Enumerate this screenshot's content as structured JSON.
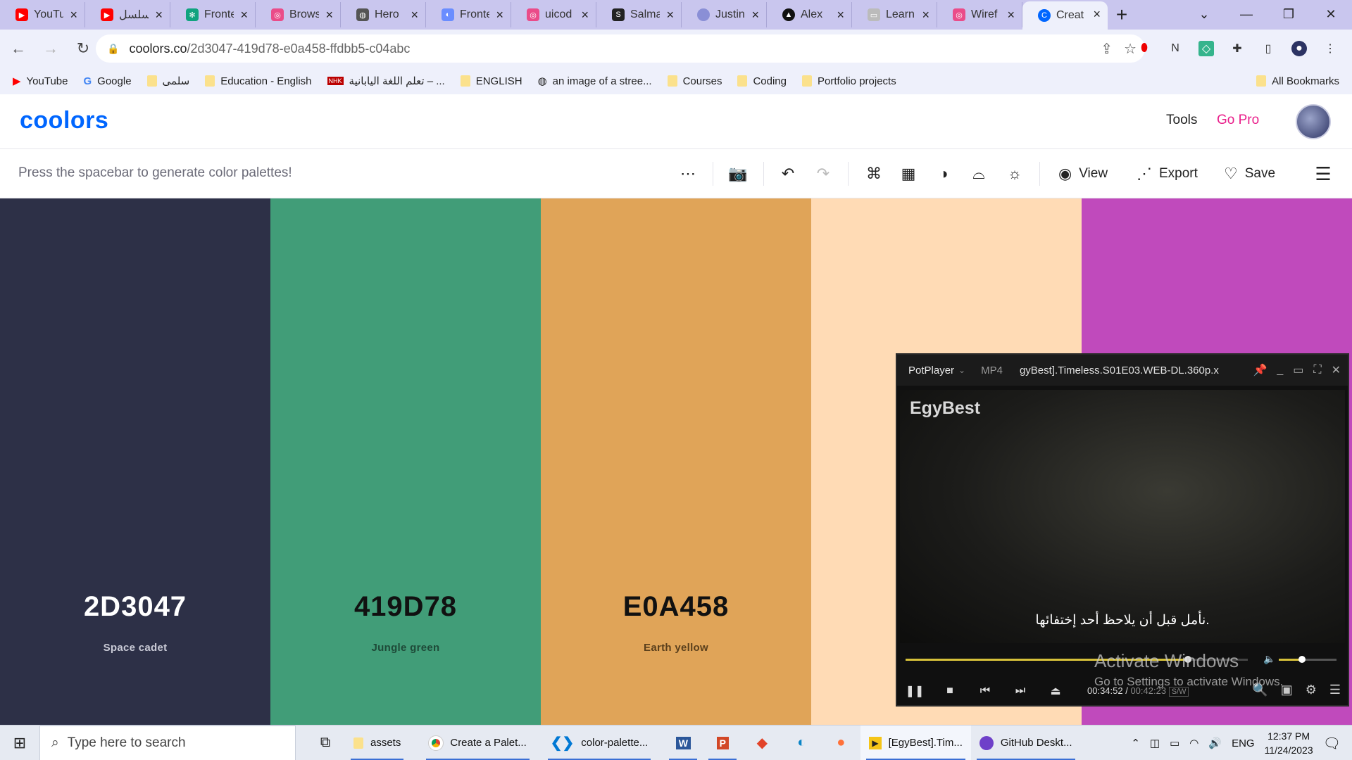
{
  "browser": {
    "tabs": [
      {
        "title": "YouTube",
        "icon": "youtube-icon",
        "color": "#ff0000"
      },
      {
        "title": "مسلسل",
        "icon": "youtube-icon",
        "color": "#ff0000"
      },
      {
        "title": "Frontend",
        "icon": "chatgpt-icon",
        "color": "#10a37f"
      },
      {
        "title": "Browse",
        "icon": "dribbble-icon",
        "color": "#ea4c89"
      },
      {
        "title": "Hero",
        "icon": "globe-icon",
        "color": "#555555"
      },
      {
        "title": "Frontend",
        "icon": "frontend-icon",
        "color": "#6a8dff"
      },
      {
        "title": "uicod",
        "icon": "dribbble-icon",
        "color": "#ea4c89"
      },
      {
        "title": "Salma",
        "icon": "s-icon",
        "color": "#222222"
      },
      {
        "title": "Justin",
        "icon": "avatar-icon",
        "color": "#8a8fd6"
      },
      {
        "title": "Alex",
        "icon": "triangle-icon",
        "color": "#111111"
      },
      {
        "title": "Learn",
        "icon": "learn-icon",
        "color": "#bbbbbb"
      },
      {
        "title": "Wiref",
        "icon": "dribbble-icon",
        "color": "#ea4c89"
      },
      {
        "title": "Creat",
        "icon": "coolors-icon",
        "color": "#0066ff"
      }
    ],
    "url_host": "coolors.co",
    "url_path": "/2d3047-419d78-e0a458-ffdbb5-c04abc",
    "bookmarks": [
      {
        "label": "YouTube",
        "icon": "youtube-icon"
      },
      {
        "label": "Google",
        "icon": "google-icon"
      },
      {
        "label": "سلمى",
        "icon": "folder-icon"
      },
      {
        "label": "Education - English",
        "icon": "folder-icon"
      },
      {
        "label": "تعلم اللغة اليابانية – ...",
        "icon": "nhk-icon"
      },
      {
        "label": "ENGLISH",
        "icon": "folder-icon"
      },
      {
        "label": "an image of a stree...",
        "icon": "globe-icon"
      },
      {
        "label": "Courses",
        "icon": "folder-icon"
      },
      {
        "label": "Coding",
        "icon": "folder-icon"
      },
      {
        "label": "Portfolio projects",
        "icon": "folder-icon"
      }
    ],
    "all_bookmarks": "All Bookmarks"
  },
  "coolors": {
    "logo": "coolors",
    "nav_tools": "Tools",
    "nav_gopro": "Go Pro",
    "hint": "Press the spacebar to generate color palettes!",
    "view": "View",
    "export": "Export",
    "save": "Save",
    "palette": [
      {
        "hex": "2D3047",
        "name": "Space cadet",
        "color": "#2d3047",
        "text_color": "#ffffff",
        "name_color": "#c9cad6"
      },
      {
        "hex": "419D78",
        "name": "Jungle green",
        "color": "#419d78",
        "text_color": "#111111",
        "name_color": "#1e4a38"
      },
      {
        "hex": "E0A458",
        "name": "Earth yellow",
        "color": "#e0a458",
        "text_color": "#111111",
        "name_color": "#5a3f1c"
      },
      {
        "hex": "",
        "name": "",
        "color": "#ffdbb5",
        "text_color": "#111111",
        "name_color": "#6b5a44"
      },
      {
        "hex": "",
        "name": "",
        "color": "#c04abc",
        "text_color": "#ffffff",
        "name_color": "#f2d2f0"
      }
    ]
  },
  "potplayer": {
    "brand": "PotPlayer",
    "format": "MP4",
    "filename": "gyBest].Timeless.S01E03.WEB-DL.360p.x",
    "watermark": "EgyBest",
    "subtitle": ".نأمل قبل أن يلاحظ أحد إختفائها",
    "time_current": "00:34:52",
    "time_total": "00:42:23",
    "badge": "S/W",
    "progress_fraction": 0.82
  },
  "watermark": {
    "line1": "Activate Windows",
    "line2": "Go to Settings to activate Windows."
  },
  "taskbar": {
    "search_placeholder": "Type here to search",
    "items": [
      {
        "label": "assets",
        "icon": "folder-icon"
      },
      {
        "label": "Create a Palet...",
        "icon": "chrome-icon"
      },
      {
        "label": "color-palette...",
        "icon": "vscode-icon"
      },
      {
        "label": "[EgyBest].Tim...",
        "icon": "potplayer-icon"
      },
      {
        "label": "GitHub Deskt...",
        "icon": "github-icon"
      }
    ],
    "lang": "ENG",
    "time": "12:37 PM",
    "date": "11/24/2023"
  }
}
